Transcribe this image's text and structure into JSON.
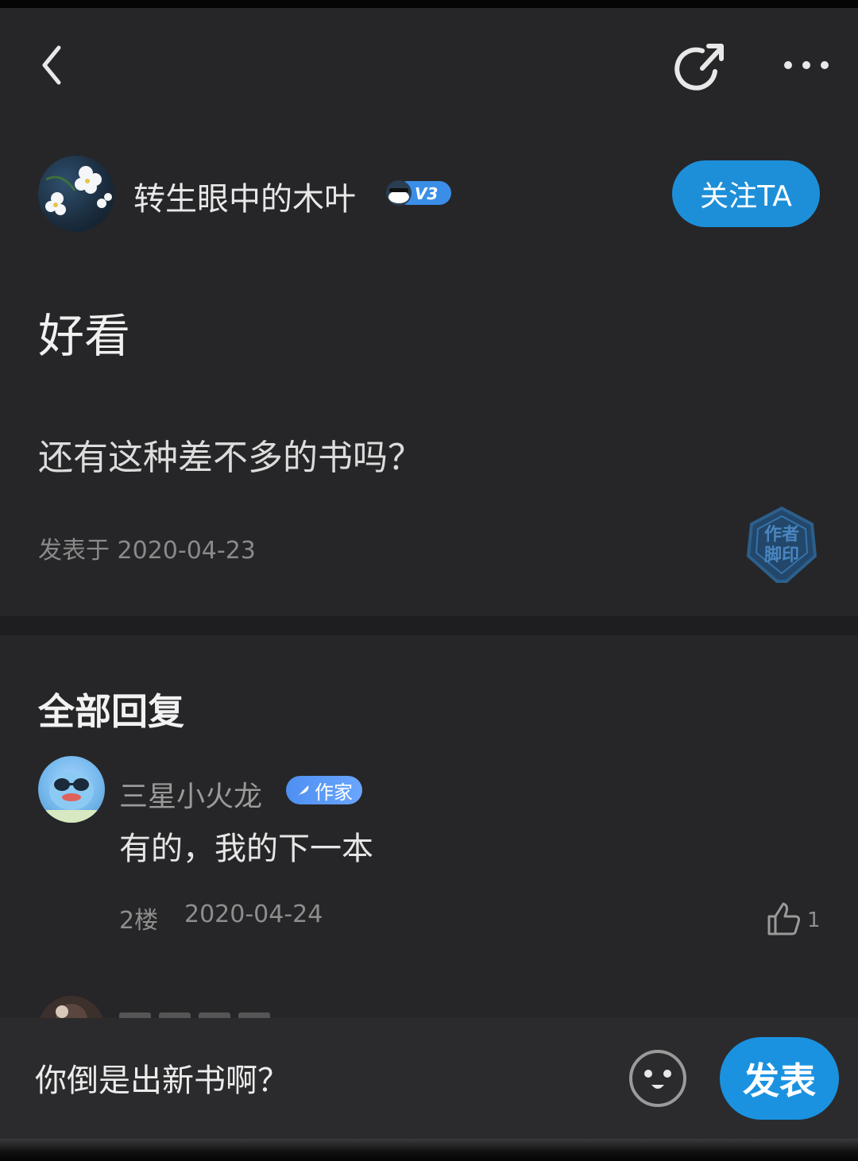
{
  "post": {
    "author_name": "转生眼中的木叶",
    "vip_level": "V3",
    "follow_label": "关注TA",
    "title": "好看",
    "body": "还有这种差不多的书吗？",
    "date_text": "发表于 2020-04-23",
    "stamp_line1": "作者",
    "stamp_line2": "脚印"
  },
  "replies": {
    "heading": "全部回复",
    "items": [
      {
        "user": "三星小火龙",
        "badge": "作家",
        "text": "有的，我的下一本",
        "floor": "2楼",
        "date": "2020-04-24",
        "likes": "1"
      }
    ]
  },
  "composer": {
    "placeholder": "你倒是出新书啊？",
    "submit_label": "发表"
  },
  "colors": {
    "background": "#262628",
    "accent": "#1d8fd8",
    "writer_badge": "#5a9bf5"
  }
}
